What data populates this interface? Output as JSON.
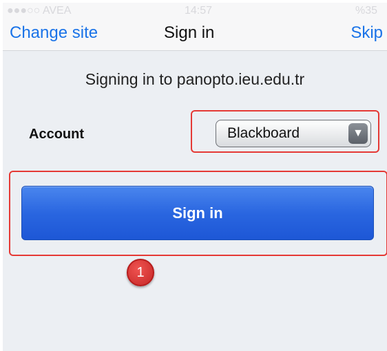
{
  "status_bar": {
    "carrier": "●●●○○ AVEA",
    "time": "14:57",
    "battery": "%35"
  },
  "nav": {
    "left_button": "Change site",
    "title": "Sign in",
    "right_button": "Skip"
  },
  "signing_text": "Signing in to panopto.ieu.edu.tr",
  "account": {
    "label": "Account",
    "selected": "Blackboard",
    "arrow_icon": "triangle-down"
  },
  "sign_in_button": "Sign in",
  "annotation": {
    "step": "1",
    "highlight_color": "#e53935"
  },
  "colors": {
    "accent": "#1a73e8",
    "button": "#2a66e0"
  }
}
